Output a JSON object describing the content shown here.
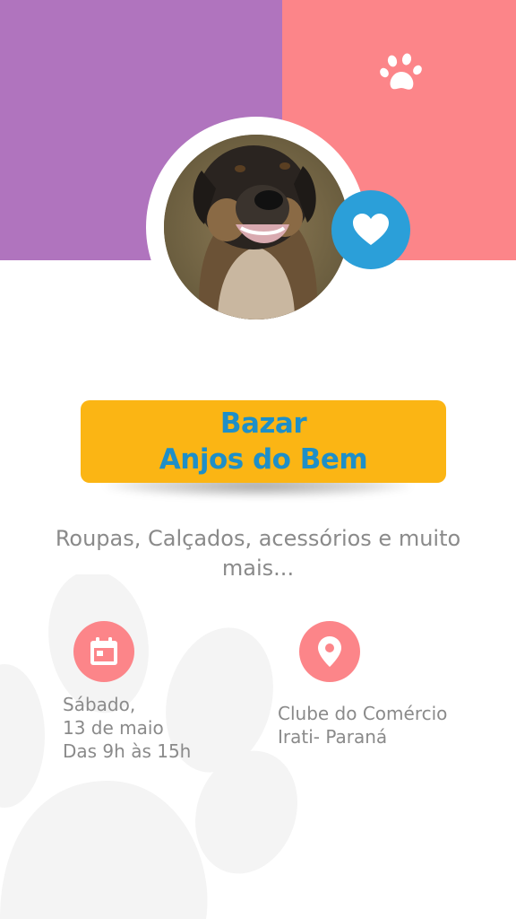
{
  "header": {
    "colors": {
      "left_block": "#b074be",
      "right_block": "#fc8589",
      "badge": "#2b9fd9"
    },
    "icons": {
      "corner": "paw-icon",
      "badge": "heart-icon"
    },
    "photo": "dog-photo"
  },
  "title": {
    "line1": "Bazar",
    "line2": "Anjos do Bem",
    "box_color": "#fbb514",
    "text_color": "#1e8fc8"
  },
  "subtitle": "Roupas, Calçados, acessórios e muito mais...",
  "date_info": {
    "icon": "calendar-icon",
    "line1": "Sábado,",
    "line2": "13 de maio",
    "line3": "Das 9h às 15h"
  },
  "location_info": {
    "icon": "location-pin-icon",
    "line1": "Clube do Comércio",
    "line2": "Irati- Paraná"
  }
}
